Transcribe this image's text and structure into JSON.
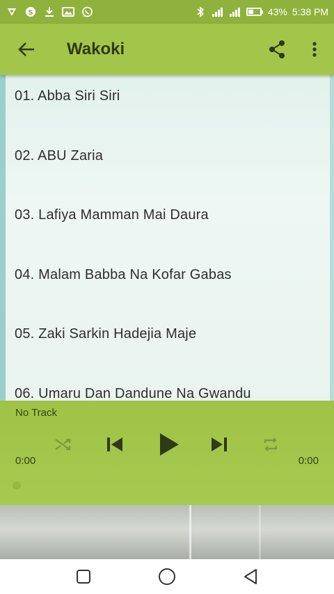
{
  "status_bar": {
    "battery_percent": "43%",
    "battery_level": 0.43,
    "time": "5:38 PM",
    "icons": [
      "vpn-icon",
      "data-saver-icon",
      "download-icon",
      "image-icon",
      "whatsapp-icon",
      "bluetooth-icon",
      "signal-icon",
      "signal-icon",
      "battery-icon"
    ]
  },
  "app_bar": {
    "title": "Wakoki",
    "icons": [
      "back-arrow-icon",
      "share-icon",
      "more-vert-icon"
    ]
  },
  "tracks": [
    {
      "label": "01. Abba Siri Siri"
    },
    {
      "label": "02. ABU Zaria"
    },
    {
      "label": "03. Lafiya Mamman Mai Daura"
    },
    {
      "label": "04. Malam Babba Na Kofar Gabas"
    },
    {
      "label": "05. Zaki Sarkin Hadejia Maje"
    },
    {
      "label": "06. Umaru Dan Dandune Na Gwandu"
    }
  ],
  "player": {
    "now_playing": "No Track",
    "elapsed": "0:00",
    "duration": "0:00",
    "progress": 0,
    "controls": [
      "shuffle-icon",
      "skip-previous-icon",
      "play-icon",
      "skip-next-icon",
      "repeat-icon"
    ]
  },
  "colors": {
    "status_bar": "#8fb23d",
    "app_bar": "#a3c64a",
    "player_bg": "#9fc347",
    "title_text": "#2d3a10"
  },
  "nav_bar": {
    "icons": [
      "recents-icon",
      "home-icon",
      "back-icon"
    ]
  }
}
